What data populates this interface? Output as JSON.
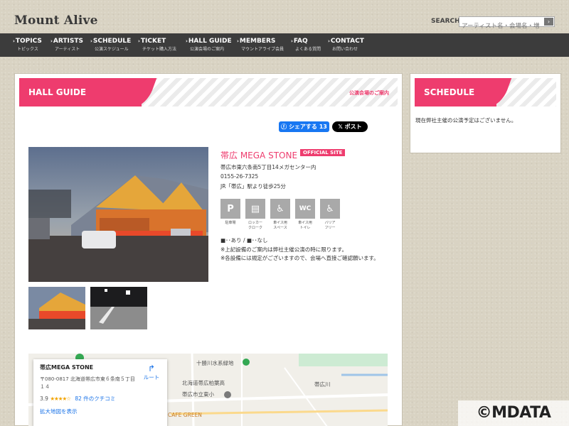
{
  "header": {
    "logo": "Mount Alive",
    "search_label": "SEARCH",
    "search_placeholder": "アーティスト名・会場名・増"
  },
  "nav": [
    {
      "en": "TOPICS",
      "ja": "トピックス"
    },
    {
      "en": "ARTISTS",
      "ja": "アーティスト"
    },
    {
      "en": "SCHEDULE",
      "ja": "公演スケジュール"
    },
    {
      "en": "TICKET",
      "ja": "チケット購入方法"
    },
    {
      "en": "HALL GUIDE",
      "ja": "公演会場のご案内"
    },
    {
      "en": "MEMBERS",
      "ja": "マウントアライブ会員"
    },
    {
      "en": "FAQ",
      "ja": "よくある質問"
    },
    {
      "en": "CONTACT",
      "ja": "お問い合わせ"
    }
  ],
  "hall_guide": {
    "title": "HALL GUIDE",
    "subtitle": "公演会場のご案内",
    "share": {
      "facebook": "シェアする 13",
      "x": "ポスト"
    },
    "venue": {
      "name": "帯広 MEGA STONE",
      "badge": "OFFICIAL SITE",
      "address": "帯広市東六条南5丁目14メガセンター内",
      "phone": "0155-26-7325",
      "access": "JR「帯広」駅より徒歩25分"
    },
    "facilities": [
      {
        "icon": "parking-icon",
        "glyph": "P",
        "label1": "駐車場",
        "label2": ""
      },
      {
        "icon": "locker-icon",
        "glyph": "▤",
        "label1": "ロッカー",
        "label2": "クローク"
      },
      {
        "icon": "wheelchair-space-icon",
        "glyph": "♿",
        "label1": "車イス用",
        "label2": "スペース"
      },
      {
        "icon": "accessible-toilet-icon",
        "glyph": "WC",
        "label1": "車イス用",
        "label2": "トイレ"
      },
      {
        "icon": "barrier-free-icon",
        "glyph": "♿",
        "label1": "バリア",
        "label2": "フリー"
      }
    ],
    "legend": "■･･あり / ■･･なし",
    "notes": [
      "※上記設備のご案内は弊社主催公演の時に限ります。",
      "※各設備には規定がございますので、会場へ直接ご確認願います。"
    ]
  },
  "map": {
    "card": {
      "name": "帯広MEGA STONE",
      "address": "〒080-0817 北海道帯広市東６条南５丁目１４",
      "rating": "3.9",
      "stars": "★★★★☆",
      "reviews": "82 件のクチコミ",
      "larger_map": "拡大地図を表示",
      "route": "ルート"
    },
    "labels": [
      "十勝川水系緑地",
      "北海道帯広柏葉高",
      "帯広市立東小",
      "帯広川",
      "CAFE GREEN"
    ]
  },
  "schedule": {
    "title": "SCHEDULE",
    "empty_message": "現在弊社主催の公演予定はございません。"
  },
  "watermark": "©MDATA",
  "colors": {
    "accent": "#ee3c6e",
    "nav_bg": "#3c3c3c",
    "facility_gray": "#a9a9a9"
  }
}
